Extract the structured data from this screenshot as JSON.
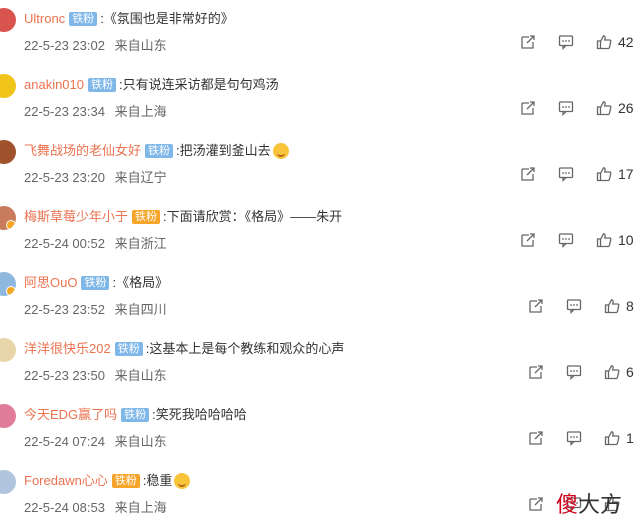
{
  "comments": [
    {
      "username": "Ultronc",
      "badge": "铁粉",
      "badge_style": "fan",
      "text": ":《氛围也是非常好的》",
      "time": "22-5-23 23:02",
      "location": "来自山东",
      "likes": "42",
      "has_emoji": false,
      "verified": false,
      "avatar_color": "#d9534f"
    },
    {
      "username": "anakin010",
      "badge": "铁粉",
      "badge_style": "fan",
      "text": ":只有说连采访都是句句鸡汤",
      "time": "22-5-23 23:34",
      "location": "来自上海",
      "likes": "26",
      "has_emoji": false,
      "verified": false,
      "avatar_color": "#f0c419"
    },
    {
      "username": "飞舞战场的老仙女好",
      "badge": "铁粉",
      "badge_style": "fan",
      "text": ":把汤灌到釜山去",
      "time": "22-5-23 23:20",
      "location": "来自辽宁",
      "likes": "17",
      "has_emoji": true,
      "verified": false,
      "avatar_color": "#a0522d"
    },
    {
      "username": "梅斯草莓少年小于",
      "badge": "铁粉",
      "badge_style": "vip",
      "text": ":下面请欣赏：《格局》——朱开",
      "time": "22-5-24 00:52",
      "location": "来自浙江",
      "likes": "10",
      "has_emoji": false,
      "verified": true,
      "avatar_color": "#c97c5d"
    },
    {
      "username": "阿思OuO",
      "badge": "铁粉",
      "badge_style": "fan",
      "text": ":《格局》",
      "time": "22-5-23 23:52",
      "location": "来自四川",
      "likes": "8",
      "has_emoji": false,
      "verified": true,
      "avatar_color": "#8fb8de"
    },
    {
      "username": "洋洋很快乐202",
      "badge": "铁粉",
      "badge_style": "fan",
      "text": ":这基本上是每个教练和观众的心声",
      "time": "22-5-23 23:50",
      "location": "来自山东",
      "likes": "6",
      "has_emoji": false,
      "verified": false,
      "avatar_color": "#e8d5a9"
    },
    {
      "username": "今天EDG赢了吗",
      "badge": "铁粉",
      "badge_style": "fan",
      "text": ":笑死我哈哈哈哈",
      "time": "22-5-24 07:24",
      "location": "来自山东",
      "likes": "1",
      "has_emoji": false,
      "verified": false,
      "avatar_color": "#e27c9b"
    },
    {
      "username": "Foredawn心心",
      "badge": "铁粉",
      "badge_style": "vip",
      "text": ":稳重",
      "time": "22-5-24 08:53",
      "location": "来自上海",
      "likes": "",
      "has_emoji": true,
      "verified": false,
      "avatar_color": "#b0c4de"
    }
  ],
  "watermark": {
    "red": "傻",
    "rest": "大方"
  },
  "icons": {
    "share": "share-icon",
    "comment": "comment-icon",
    "like": "thumbs-up-icon"
  },
  "colors": {
    "username": "#eb7350",
    "badge_fan": "#7fb7e8",
    "badge_vip": "#f7a42a",
    "text": "#333333",
    "meta": "#666666"
  }
}
